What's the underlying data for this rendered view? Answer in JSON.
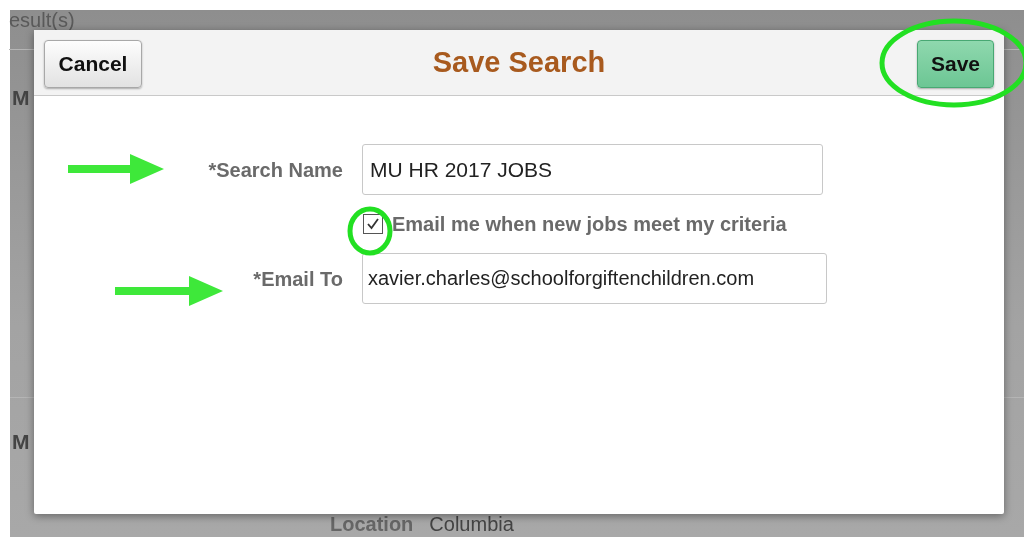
{
  "background": {
    "header_text": "esult(s)",
    "row_labels": [
      "M",
      "M"
    ],
    "location": {
      "label": "Location",
      "value": "Columbia"
    }
  },
  "dialog": {
    "title": "Save Search",
    "cancel_button": "Cancel",
    "save_button": "Save",
    "search_name": {
      "label": "*Search Name",
      "value": "MU HR 2017 JOBS"
    },
    "email_option": {
      "label": "Email me when new jobs meet my criteria",
      "checked": true
    },
    "email_to": {
      "label": "*Email To",
      "value": "xavier.charles@schoolforgiftenchildren.com"
    }
  }
}
